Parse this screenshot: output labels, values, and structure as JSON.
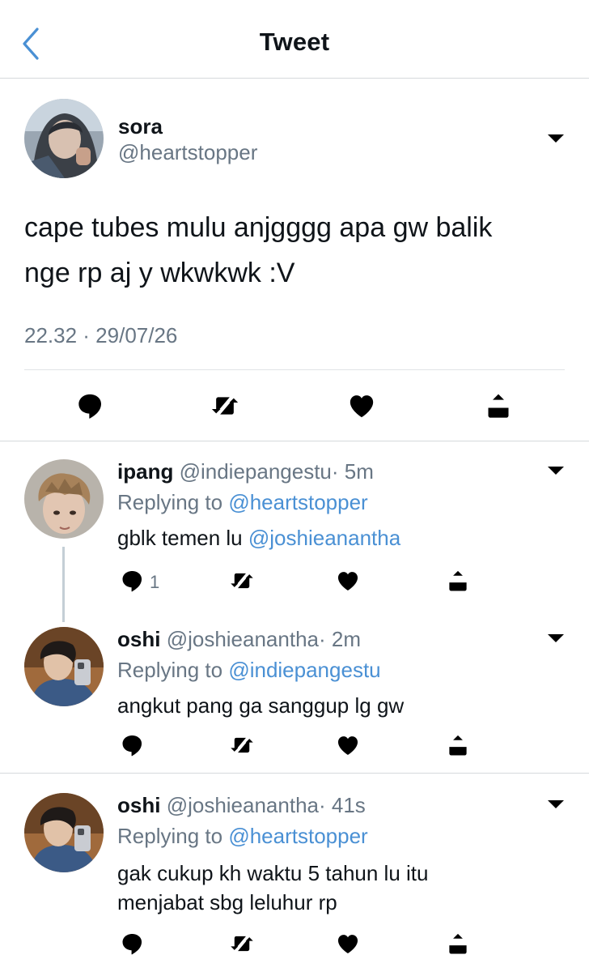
{
  "header": {
    "title": "Tweet"
  },
  "main_tweet": {
    "display_name": "sora",
    "handle": "@heartstopper",
    "text_line1": "cape tubes mulu anjgggg apa gw balik",
    "text_line2": "nge rp aj y wkwkwk :V",
    "timestamp": "22.32 · 29/07/26"
  },
  "replies": [
    {
      "display_name": "ipang",
      "handle": "@indiepangestu",
      "time": "· 5m",
      "replying_prefix": "Replying to",
      "replying_to": "@heartstopper",
      "text": "gblk temen lu",
      "mention": "@joshieanantha",
      "reply_count": "1"
    },
    {
      "display_name": "oshi",
      "handle": "@joshieanantha",
      "time": "· 2m",
      "replying_prefix": "Replying to",
      "replying_to": "@indiepangestu",
      "text": "angkut pang ga sanggup lg gw"
    },
    {
      "display_name": "oshi",
      "handle": "@joshieanantha",
      "time": "· 41s",
      "replying_prefix": "Replying to",
      "replying_to": "@heartstopper",
      "text_line1": "gak cukup kh waktu 5 tahun lu itu",
      "text_line2": "menjabat sbg leluhur rp"
    }
  ],
  "icons": {
    "back": "chevron-left-icon",
    "more": "chevron-down-icon",
    "reply": "reply-bubble-icon",
    "retweet": "retweet-icon",
    "like": "heart-icon",
    "share": "share-icon"
  },
  "colors": {
    "accent": "#4a90d4",
    "text": "#0f1419",
    "secondary": "#687684",
    "divider": "#d6d9dc"
  }
}
